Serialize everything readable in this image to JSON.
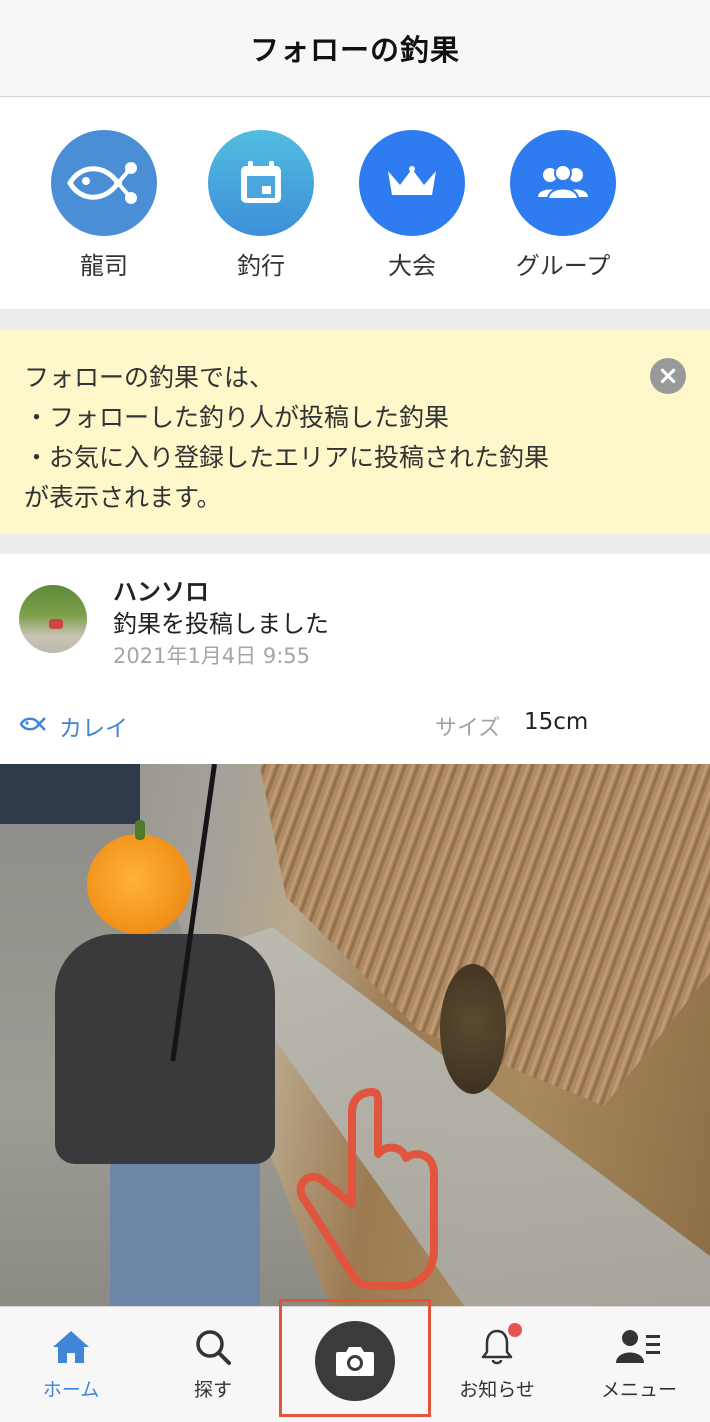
{
  "header": {
    "title": "フォローの釣果"
  },
  "shortcuts": [
    {
      "label": "龍司",
      "icon": "fish-share-icon",
      "color": "#4a8fd6"
    },
    {
      "label": "釣行",
      "icon": "calendar-icon",
      "color": "#4aa6dc"
    },
    {
      "label": "大会",
      "icon": "crown-icon",
      "color": "#2e7cf0"
    },
    {
      "label": "グループ",
      "icon": "group-icon",
      "color": "#2e7cf0"
    }
  ],
  "notice": {
    "lines": [
      "フォローの釣果では、",
      "・フォローした釣り人が投稿した釣果",
      "・お気に入り登録したエリアに投稿された釣果",
      "が表示されます。"
    ],
    "close_icon": "close-icon"
  },
  "post": {
    "user_name": "ハンソロ",
    "action": "釣果を投稿しました",
    "timestamp": "2021年1月4日 9:55",
    "species": "カレイ",
    "size_label": "サイズ",
    "size_value": "15cm"
  },
  "tabbar": {
    "items": [
      {
        "label": "ホーム",
        "icon": "home-icon",
        "active": true
      },
      {
        "label": "探す",
        "icon": "search-icon",
        "active": false
      },
      {
        "label": "",
        "icon": "camera-icon",
        "active": false
      },
      {
        "label": "お知らせ",
        "icon": "bell-icon",
        "active": false,
        "badge": true
      },
      {
        "label": "メニュー",
        "icon": "user-menu-icon",
        "active": false
      }
    ]
  },
  "colors": {
    "accent": "#3f86d8",
    "notice_bg": "#fdf7c9",
    "highlight": "#e1553f"
  }
}
